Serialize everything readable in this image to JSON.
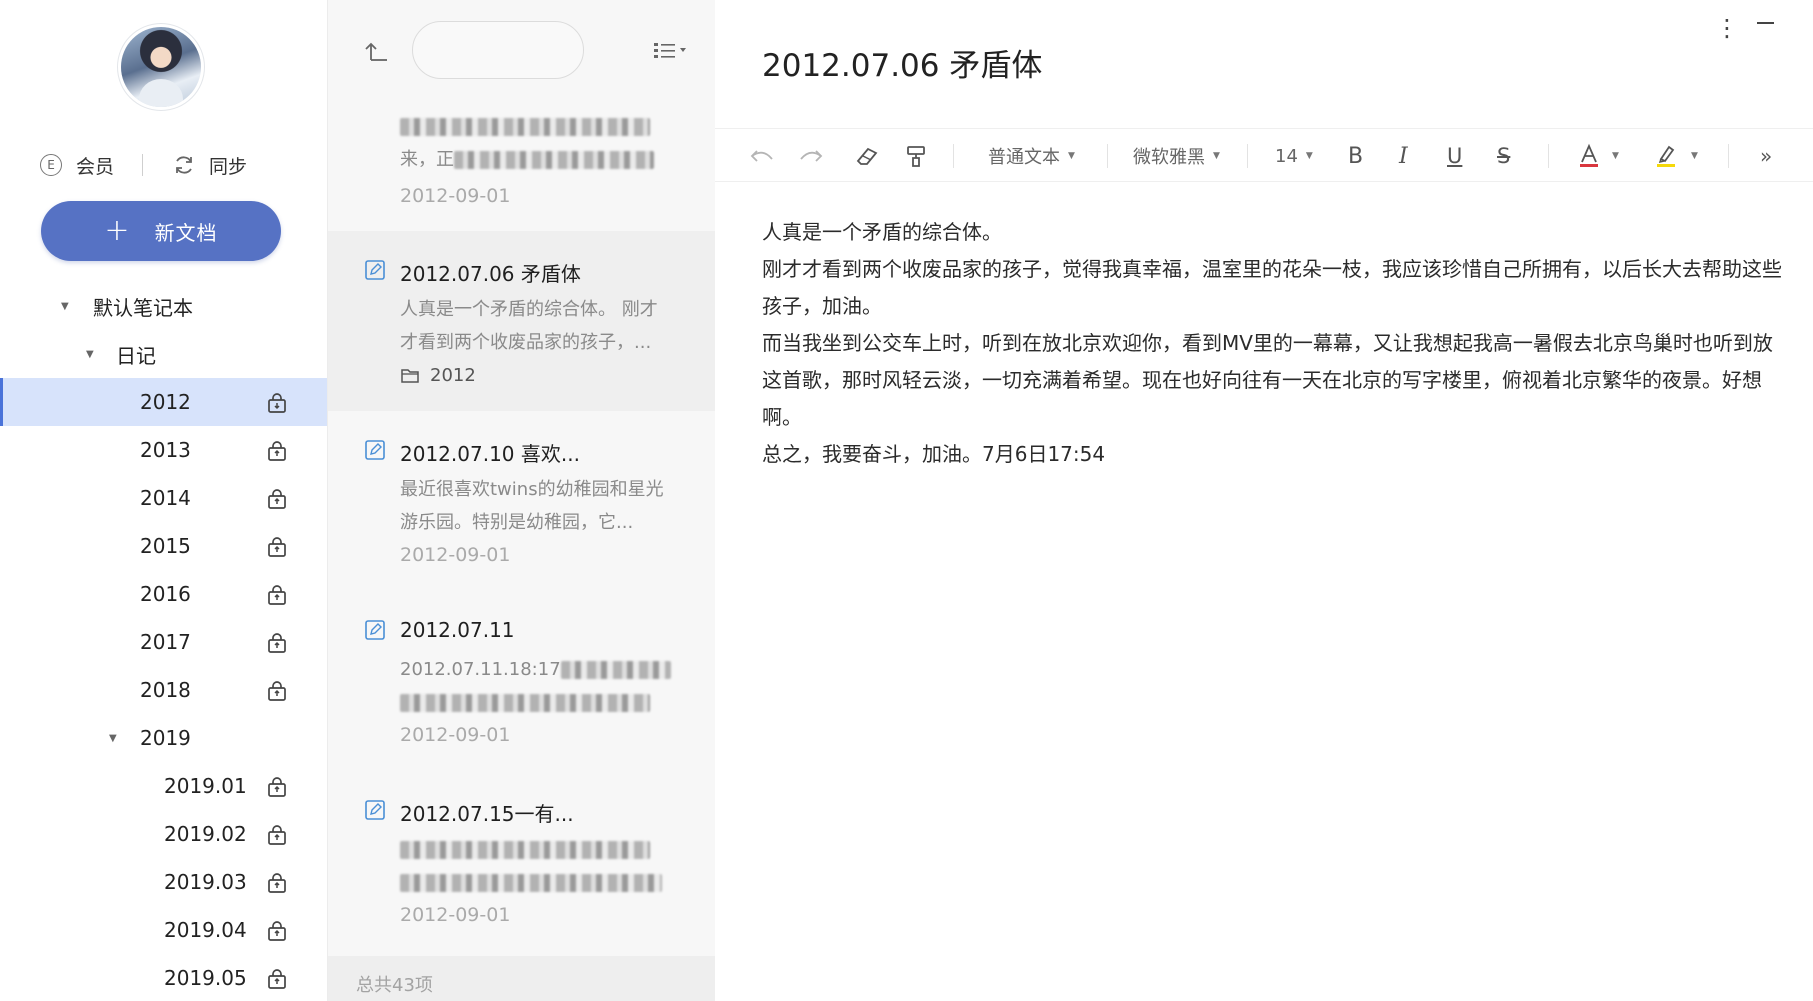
{
  "sidebar": {
    "member_label": "会员",
    "sync_label": "同步",
    "new_doc_label": "新文档",
    "notebook": "默认笔记本",
    "diary": "日记",
    "years": [
      "2012",
      "2013",
      "2014",
      "2015",
      "2016",
      "2017",
      "2018"
    ],
    "year_2019": "2019",
    "months_2019": [
      "2019.01",
      "2019.02",
      "2019.03",
      "2019.04",
      "2019.05"
    ],
    "selected": "2012"
  },
  "notelist": {
    "search_placeholder": "",
    "items": [
      {
        "title": "",
        "excerpt_line2_prefix": "来，正",
        "date": "2012-09-01"
      },
      {
        "title": "2012.07.06 矛盾体",
        "excerpt": "人真是一个矛盾的综合体。 刚才才看到两个收废品家的孩子，...",
        "folder": "2012"
      },
      {
        "title": "2012.07.10 喜欢...",
        "excerpt": "最近很喜欢twins的幼稚园和星光游乐园。特别是幼稚园，它...",
        "date": "2012-09-01"
      },
      {
        "title": "2012.07.11",
        "excerpt_prefix": "2012.07.11.18:17",
        "date": "2012-09-01"
      },
      {
        "title": "2012.07.15一有...",
        "excerpt": "",
        "date": "2012-09-01"
      }
    ],
    "footer": "总共43项"
  },
  "editor": {
    "title": "2012.07.06 矛盾体",
    "toolbar": {
      "paragraph_style": "普通文本",
      "font": "微软雅黑",
      "font_size": "14"
    },
    "text_color": "#d9363e",
    "highlight_color": "#f5d90a",
    "body": [
      "人真是一个矛盾的综合体。",
      "刚才才看到两个收废品家的孩子，觉得我真幸福，温室里的花朵一枝，我应该珍惜自己所拥有，以后长大去帮助这些孩子，加油。",
      "而当我坐到公交车上时，听到在放北京欢迎你，看到MV里的一幕幕，又让我想起我高一暑假去北京鸟巢时也听到放这首歌，那时风轻云淡，一切充满着希望。现在也好向往有一天在北京的写字楼里，俯视着北京繁华的夜景。好想啊。",
      "总之，我要奋斗，加油。7月6日17:54"
    ]
  },
  "colors": {
    "accent": "#5672c4",
    "selected_row": "#d7e3fb"
  }
}
